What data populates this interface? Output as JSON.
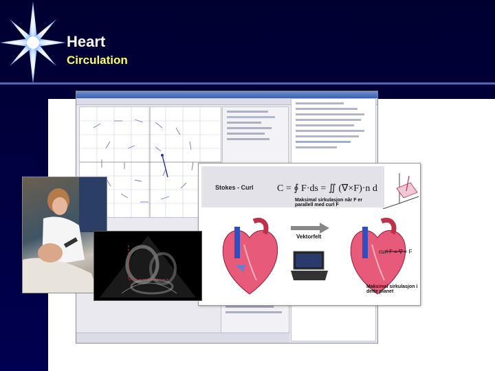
{
  "slide": {
    "title": "Heart",
    "subtitle": "Circulation"
  },
  "inset": {
    "stokes_label": "Stokes - Curl",
    "max_circ_parallel": "Maksimal sirkulasjon når F er parallell med curl F",
    "vektorfelt_label": "Vektorfelt",
    "max_circ_plane": "Maksimal sirkulasjon i dette planet",
    "curl_formula": "curl F = ∇ × F"
  },
  "colors": {
    "background": "#000033",
    "title": "#ffffff",
    "subtitle": "#ffff66"
  },
  "icons": [
    "starburst-logo",
    "vector-field-plot",
    "heart-diagram",
    "ultrasound-image"
  ]
}
